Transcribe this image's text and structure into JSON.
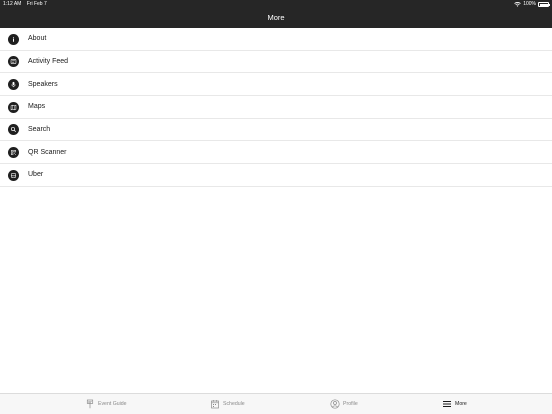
{
  "status_bar": {
    "time": "1:12 AM",
    "date": "Fri Feb 7",
    "battery": "100%"
  },
  "nav": {
    "title": "More"
  },
  "menu": {
    "items": [
      {
        "label": "About",
        "icon": "info-icon"
      },
      {
        "label": "Activity Feed",
        "icon": "activity-feed-icon"
      },
      {
        "label": "Speakers",
        "icon": "speaker-icon"
      },
      {
        "label": "Maps",
        "icon": "map-icon"
      },
      {
        "label": "Search",
        "icon": "search-icon"
      },
      {
        "label": "QR Scanner",
        "icon": "qr-icon"
      },
      {
        "label": "Uber",
        "icon": "car-icon"
      }
    ]
  },
  "tabs": [
    {
      "label": "Event Guide",
      "icon": "event-guide-icon",
      "active": false
    },
    {
      "label": "Schedule",
      "icon": "calendar-icon",
      "active": false
    },
    {
      "label": "Profile",
      "icon": "profile-icon",
      "active": false
    },
    {
      "label": "More",
      "icon": "hamburger-icon",
      "active": true
    }
  ],
  "colors": {
    "header_bg": "#262626",
    "icon_bg": "#1f1f1f",
    "tab_bar_bg": "#f7f7f7",
    "active_tab": "#1a1a1a",
    "inactive_tab": "#8a8a8a"
  }
}
